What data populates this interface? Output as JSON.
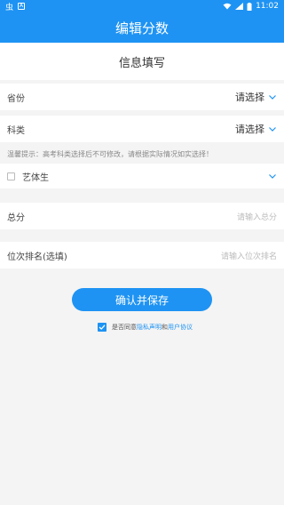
{
  "status_bar": {
    "left_glyph": "虫",
    "left_box": "A",
    "time": "11:02"
  },
  "header": {
    "title": "编辑分数"
  },
  "form": {
    "section_title": "信息填写",
    "province": {
      "label": "省份",
      "value": "请选择"
    },
    "subject": {
      "label": "科类",
      "value": "请选择"
    },
    "tip": "温馨提示：高考科类选择后不可修改，请根据实际情况如实选择！",
    "art_student": {
      "label": "艺体生",
      "checked": false
    },
    "score": {
      "label": "总分",
      "placeholder": "请输入总分"
    },
    "rank": {
      "label": "位次排名(选填)",
      "placeholder": "请输入位次排名"
    }
  },
  "actions": {
    "save_label": "确认并保存"
  },
  "agreement": {
    "checked": true,
    "prefix": "是否同意",
    "privacy": "隐私声明",
    "and": "和",
    "terms": "用户协议"
  },
  "colors": {
    "accent": "#1e93f3",
    "background": "#f4f4f4"
  }
}
